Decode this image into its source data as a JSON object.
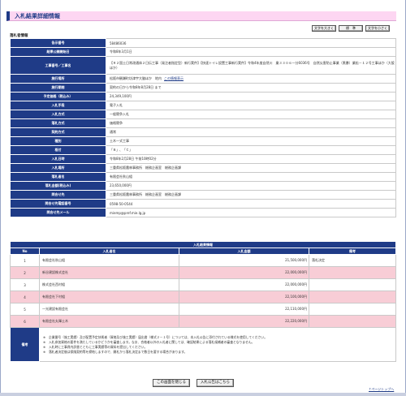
{
  "title": "入札結果詳細情報",
  "font_buttons": [
    "文字を大きく",
    "標　準",
    "文字を小さく"
  ],
  "section_label": "落札者情報",
  "info_rows": [
    {
      "label": "告示番号",
      "value": "58486036"
    },
    {
      "label": "結果公開開始日",
      "value": "令和8年3月1日"
    },
    {
      "label": "工事番号／工事名",
      "value": "【Ｒ２国土日常改通体２日伝工事（発注者指定型）新行実件】【快速トイレ設置工事新行実件】令和4年度自然川　業３３０６一分6036号　自然災害防止事業（黒暴）業松－１２号工事ほか（大阪ほか）",
      "tall": true
    },
    {
      "label": "施行場所",
      "value": "松阪市観瀬町坊津宇大脇ほか　地内",
      "link": "この情報表示"
    },
    {
      "label": "施行期間",
      "value": "契約の日から令和8年8月28日 まで"
    },
    {
      "label": "予定価格（税込み）",
      "value": "24,349,100円"
    },
    {
      "label": "入札手段",
      "value": "電子入札"
    },
    {
      "label": "入札方式",
      "value": "一般競争入札"
    },
    {
      "label": "落札方式",
      "value": "価格競争"
    },
    {
      "label": "契約方式",
      "value": "通常"
    },
    {
      "label": "種別",
      "value": "土木一式工事"
    },
    {
      "label": "格付",
      "value": "「Ｂ」、「Ｃ」"
    },
    {
      "label": "入札日時",
      "value": "令和8年2月28日 午前10時02分"
    },
    {
      "label": "入札場所",
      "value": "三重県松阪農林事務所　総務企画室　総務企画課"
    },
    {
      "label": "落札者名",
      "value": "有限会社秋山組"
    },
    {
      "label": "落札金額(税込み)",
      "value": "23,650,000円"
    },
    {
      "label": "問合せ先",
      "value": "三重県松阪農林事務所　総務企画室　総務企画課"
    },
    {
      "label": "問合せ先電話番号",
      "value": "0598-50-0544"
    },
    {
      "label": "問合せ先メール",
      "value": "miemp@pref.mie.lg.jp"
    }
  ],
  "results": {
    "caption": "入札結果情報",
    "headers": [
      "No",
      "入札者名",
      "入札金額",
      "備考"
    ],
    "rows": [
      {
        "no": "1",
        "name": "有限会社秋山組",
        "amount": "21,500,000円",
        "note": "落札決定",
        "color": "white"
      },
      {
        "no": "2",
        "name": "新谷建設株式会社",
        "amount": "22,000,000円",
        "note": "",
        "color": "pink"
      },
      {
        "no": "3",
        "name": "株式会社西村組",
        "amount": "22,000,000円",
        "note": "",
        "color": "white"
      },
      {
        "no": "4",
        "name": "有限会社下村組",
        "amount": "22,100,000円",
        "note": "",
        "color": "pink"
      },
      {
        "no": "5",
        "name": "一光建設有限会社",
        "amount": "22,110,000円",
        "note": "",
        "color": "white"
      },
      {
        "no": "6",
        "name": "有限会社丸輝土木",
        "amount": "22,220,000円",
        "note": "",
        "color": "pink"
      }
    ],
    "remarks_label": "備考",
    "remarks": [
      "※　企業番号（施工実績）及び配置予定技術者（資格及び施工実績）届出書（様式２－１号）については、本入札公告に添付されている様式を使用してください。",
      "※　入札参加資格の要件を満たしているかどうかを審査します。なお、合格者以外の入札者に関しては、確認結果による落札候補者の審査となりません。",
      "※　入札時に工事費内訳書とともに工事実績等の資料を提出してください。",
      "※　落札者決定後は保険契約等を締結しますので、開札から落札決定まで数日を要する場合があります。"
    ]
  },
  "bottom_buttons": [
    "この画面を閉じる",
    "入札公告はこちら"
  ],
  "page_top": "↑ページトップへ"
}
